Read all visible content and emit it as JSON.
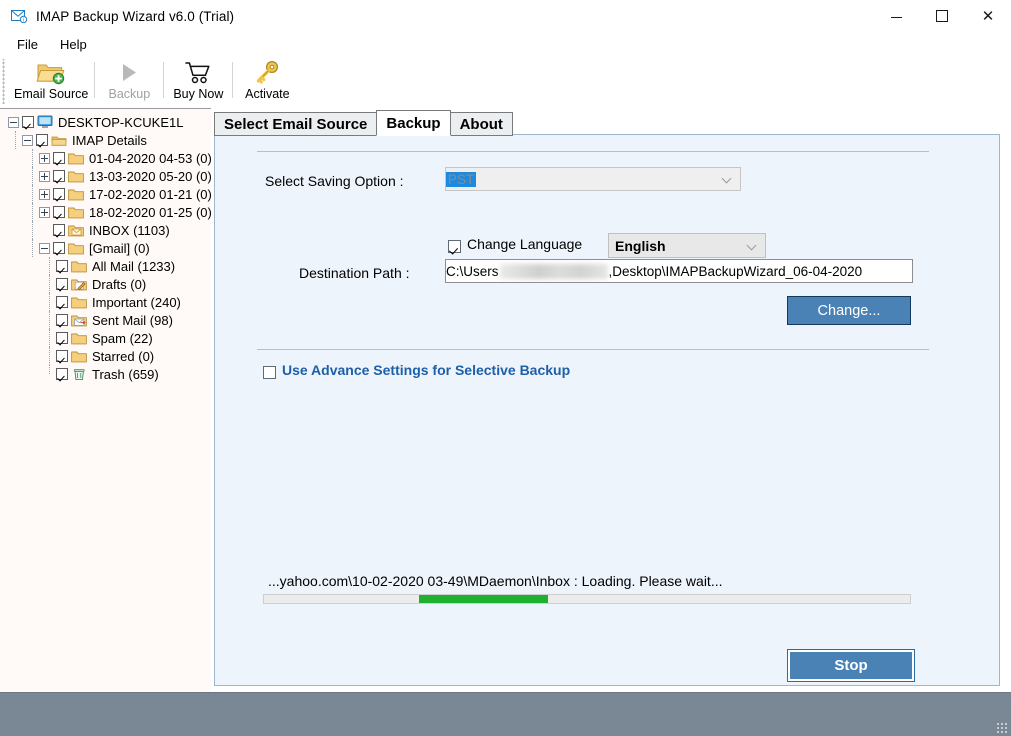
{
  "window": {
    "title": "IMAP Backup Wizard v6.0 (Trial)",
    "icon": "mail-envelope-icon",
    "minimize_label": "—",
    "maximize_label": "",
    "close_label": "✕"
  },
  "menubar": {
    "items": [
      {
        "label": "File",
        "name": "menu-file"
      },
      {
        "label": "Help",
        "name": "menu-help"
      }
    ]
  },
  "toolbar": {
    "items": [
      {
        "label": "Email Source",
        "icon": "folder-add-icon",
        "disabled": false
      },
      {
        "label": "Backup",
        "icon": "play-triangle-icon",
        "disabled": true
      },
      {
        "label": "Buy Now",
        "icon": "shopping-cart-icon",
        "disabled": false
      },
      {
        "label": "Activate",
        "icon": "key-icon",
        "disabled": false
      }
    ]
  },
  "tree": {
    "nodes": [
      {
        "label": "DESKTOP-KCUKE1L",
        "level": 1,
        "expander": "minus",
        "checked": true,
        "icon": "computer-icon"
      },
      {
        "label": "IMAP Details",
        "level": 2,
        "expander": "minus",
        "checked": true,
        "icon": "stacked-folders-icon"
      },
      {
        "label": "01-04-2020 04-53 (0)",
        "level": 3,
        "expander": "plus",
        "checked": true,
        "icon": "folder-icon"
      },
      {
        "label": "13-03-2020 05-20 (0)",
        "level": 3,
        "expander": "plus",
        "checked": true,
        "icon": "folder-icon"
      },
      {
        "label": "17-02-2020 01-21 (0)",
        "level": 3,
        "expander": "plus",
        "checked": true,
        "icon": "folder-icon"
      },
      {
        "label": "18-02-2020 01-25 (0)",
        "level": 3,
        "expander": "plus",
        "checked": true,
        "icon": "folder-icon"
      },
      {
        "label": "INBOX (1103)",
        "level": 3,
        "expander": "none",
        "checked": true,
        "icon": "inbox-folder-icon"
      },
      {
        "label": "[Gmail] (0)",
        "level": 3,
        "expander": "minus",
        "checked": true,
        "icon": "folder-icon"
      },
      {
        "label": "All Mail (1233)",
        "level": 4,
        "expander": "none",
        "checked": true,
        "icon": "folder-icon"
      },
      {
        "label": "Drafts (0)",
        "level": 4,
        "expander": "none",
        "checked": true,
        "icon": "drafts-folder-icon"
      },
      {
        "label": "Important (240)",
        "level": 4,
        "expander": "none",
        "checked": true,
        "icon": "folder-icon"
      },
      {
        "label": "Sent Mail (98)",
        "level": 4,
        "expander": "none",
        "checked": true,
        "icon": "sent-folder-icon"
      },
      {
        "label": "Spam (22)",
        "level": 4,
        "expander": "none",
        "checked": true,
        "icon": "folder-icon"
      },
      {
        "label": "Starred (0)",
        "level": 4,
        "expander": "none",
        "checked": true,
        "icon": "folder-icon"
      },
      {
        "label": "Trash (659)",
        "level": 4,
        "expander": "none",
        "checked": true,
        "icon": "trash-folder-icon"
      }
    ]
  },
  "tabs": [
    {
      "label": "Select Email Source",
      "active": false
    },
    {
      "label": "Backup",
      "active": true
    },
    {
      "label": "About",
      "active": false
    }
  ],
  "backup_form": {
    "saving_option_label": "Select Saving Option :",
    "saving_option_value": "PST",
    "change_language_label": "Change Language",
    "change_language_checked": true,
    "language_value": "English",
    "destination_label": "Destination Path :",
    "destination_prefix": "C:\\Users",
    "destination_suffix": ",Desktop\\IMAPBackupWizard_06-04-2020",
    "change_button": "Change...",
    "advance_settings_label": "Use Advance Settings for Selective Backup",
    "advance_settings_checked": false
  },
  "progress": {
    "status_text": "...yahoo.com\\10-02-2020 03-49\\MDaemon\\Inbox : Loading. Please wait...",
    "bar_color": "#20b030",
    "chunk_start_pct": 24,
    "chunk_width_pct": 20
  },
  "actions": {
    "stop_button": "Stop"
  },
  "colors": {
    "panel_bg": "#eef4fc",
    "tree_bg": "#fffaf7",
    "accent_blue": "#4a82b6",
    "link_blue": "#1d5fa8",
    "statusbar": "#7a8795",
    "progress_green": "#20b030"
  }
}
